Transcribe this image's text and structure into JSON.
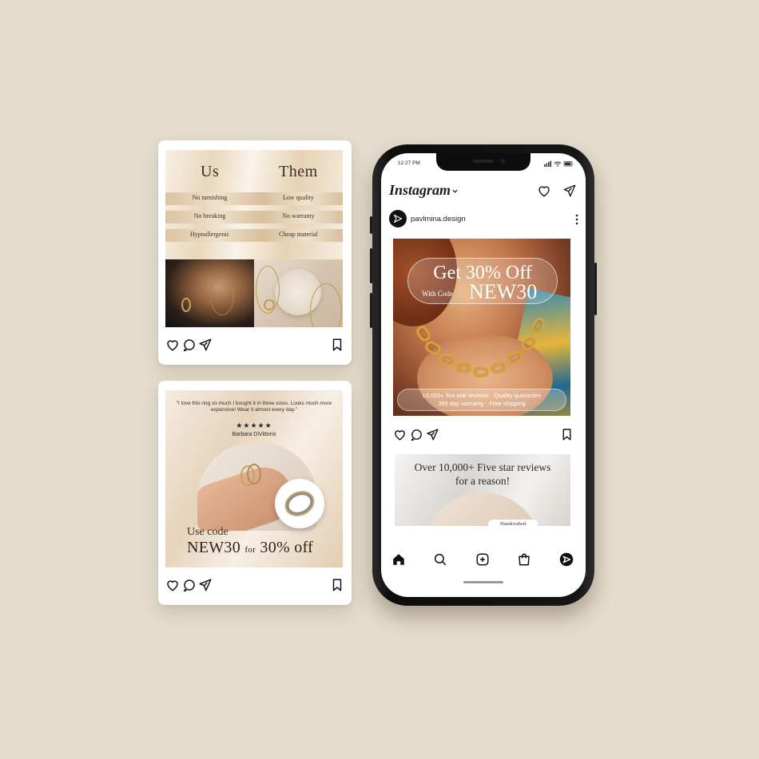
{
  "card_comparison": {
    "heading_us": "Us",
    "heading_them": "Them",
    "rows": [
      {
        "us": "No tarnishing",
        "them": "Low quality"
      },
      {
        "us": "No breaking",
        "them": "No warranty"
      },
      {
        "us": "Hypoallergenic",
        "them": "Cheap material"
      }
    ]
  },
  "card_review": {
    "quote": "\"I love this ring so much I bought it in three sizes. Looks much more expensive! Wear it almost every day.\"",
    "stars": "★★★★★",
    "reviewer": "Barbara DiVittorio",
    "use_code": "Use code",
    "code": "NEW30",
    "for": "for",
    "discount": "30% off"
  },
  "phone": {
    "status_time": "12:27 PM",
    "app_title": "Instagram",
    "username": "pavlmina.design",
    "post1": {
      "headline": "Get 30% Off",
      "with_code": "With Code",
      "code": "NEW30",
      "reviews_line1": "10,000+ five star reviews · Quality guarantee",
      "reviews_line2": "365 day warranty · Free shipping"
    },
    "post2": {
      "title_line1": "Over 10,000+ Five star reviews",
      "title_line2": "for a reason!",
      "badge": "Handcrafted"
    }
  },
  "colors": {
    "background": "#e5dccd",
    "gold": "#d8a13a",
    "text_dark": "#2b2b2b"
  },
  "icons": [
    "heart-icon",
    "comment-icon",
    "send-icon",
    "bookmark-icon",
    "home-icon",
    "search-icon",
    "add-icon",
    "shop-icon",
    "chevron-down-icon",
    "more-icon"
  ]
}
